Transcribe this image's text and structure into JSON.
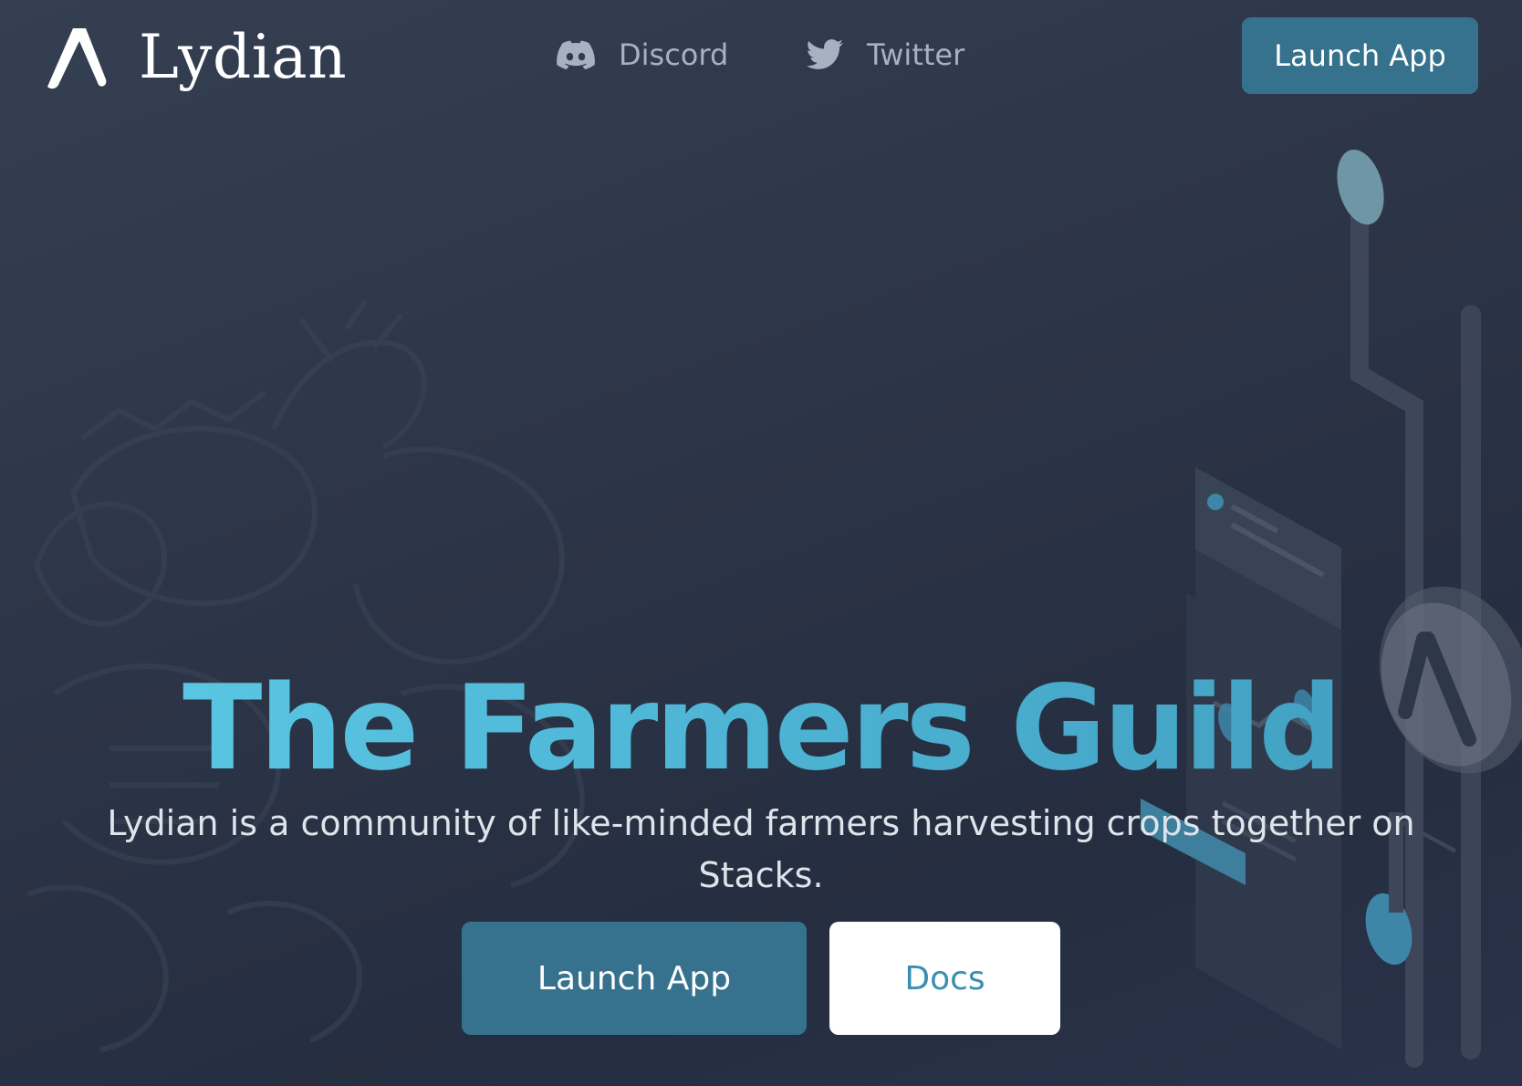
{
  "header": {
    "brand": "Lydian",
    "nav": [
      {
        "label": "Discord",
        "icon": "discord-icon"
      },
      {
        "label": "Twitter",
        "icon": "twitter-icon"
      }
    ],
    "cta_label": "Launch App"
  },
  "hero": {
    "title": "The Farmers Guild",
    "subtitle": "Lydian is a community of like-minded farmers harvesting crops together on Stacks.",
    "primary_button": "Launch App",
    "secondary_button": "Docs"
  },
  "colors": {
    "background": "#2d3648",
    "accent": "#36728d",
    "title_gradient_start": "#5dcbe6",
    "title_gradient_end": "#3f9cbd",
    "nav_text": "#a7b1c2"
  }
}
